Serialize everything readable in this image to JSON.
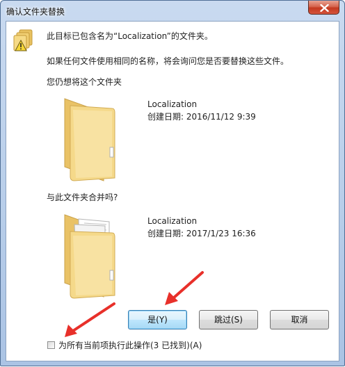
{
  "window": {
    "title": "确认文件夹替换"
  },
  "message": {
    "line1": "此目标已包含名为“Localization”的文件夹。",
    "line2": "如果任何文件使用相同的名称，将会询问您是否要替换这些文件。",
    "line3": "您仍想将这个文件夹"
  },
  "existing": {
    "name": "Localization",
    "date": "创建日期: 2016/11/12 9:39"
  },
  "merge_prompt": "与此文件夹合并吗?",
  "incoming": {
    "name": "Localization",
    "date": "创建日期: 2017/1/23 16:36"
  },
  "buttons": {
    "yes": "是(Y)",
    "skip": "跳过(S)",
    "cancel": "取消"
  },
  "checkbox": {
    "label": "为所有当前项执行此操作(3 已找到)(A)",
    "checked": false
  },
  "colors": {
    "folder": "#f3d27a",
    "annotation_arrow": "#e8302a"
  },
  "icons": [
    "close-icon",
    "warning-icon",
    "folder-icon"
  ]
}
